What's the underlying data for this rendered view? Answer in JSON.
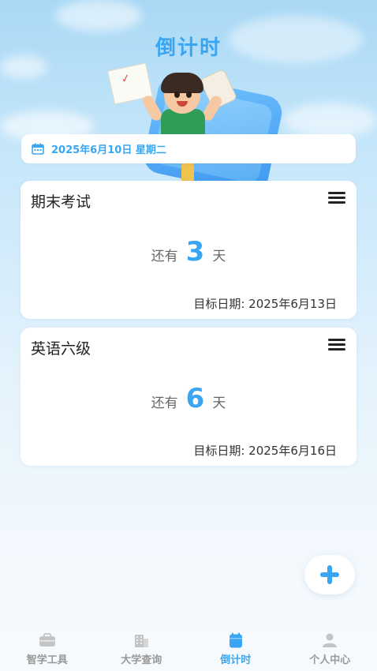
{
  "header": {
    "title": "倒计时"
  },
  "date_bar": {
    "date": "2025年6月10日 星期二"
  },
  "countdowns": [
    {
      "title": "期末考试",
      "prefix": "还有",
      "days": "3",
      "suffix": "天",
      "target": "目标日期: 2025年6月13日"
    },
    {
      "title": "英语六级",
      "prefix": "还有",
      "days": "6",
      "suffix": "天",
      "target": "目标日期: 2025年6月16日"
    }
  ],
  "tabbar": {
    "items": [
      {
        "label": "智学工具",
        "icon": "toolbox-icon",
        "active": false
      },
      {
        "label": "大学查询",
        "icon": "building-icon",
        "active": false
      },
      {
        "label": "倒计时",
        "icon": "calendar-icon",
        "active": true
      },
      {
        "label": "个人中心",
        "icon": "person-icon",
        "active": false
      }
    ]
  },
  "colors": {
    "accent": "#3aa6f2",
    "inactive": "#999999",
    "background_top": "#a9d8f5"
  }
}
